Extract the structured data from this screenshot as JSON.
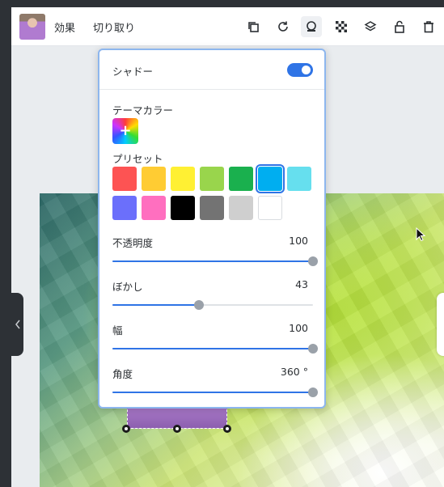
{
  "toolbar": {
    "effects_label": "効果",
    "crop_label": "切り取り",
    "icons": [
      "duplicate-icon",
      "rotate-icon",
      "shadow-icon",
      "transparency-icon",
      "layers-icon",
      "lock-icon",
      "delete-icon"
    ]
  },
  "shadow_panel": {
    "title": "シャドー",
    "enabled": true,
    "theme_color_label": "テーマカラー",
    "presets_label": "プリセット",
    "preset_colors": [
      "#fd5353",
      "#ffcc33",
      "#fff033",
      "#99d54c",
      "#1ab04e",
      "#00aef0",
      "#66dfee",
      "#6b6ffb",
      "#ff6fbf",
      "#000000",
      "#737373",
      "#cfcfcf",
      "#ffffff"
    ],
    "selected_preset": "#00aef0",
    "sliders": [
      {
        "label": "不透明度",
        "value": "100",
        "fraction": 1.0
      },
      {
        "label": "ぼかし",
        "value": "43",
        "fraction": 0.43
      },
      {
        "label": "幅",
        "value": "100",
        "fraction": 1.0
      },
      {
        "label": "角度",
        "value": "360 °",
        "fraction": 1.0
      }
    ]
  },
  "colors": {
    "accent": "#2f74e6",
    "panel_border": "#8db6ee"
  }
}
